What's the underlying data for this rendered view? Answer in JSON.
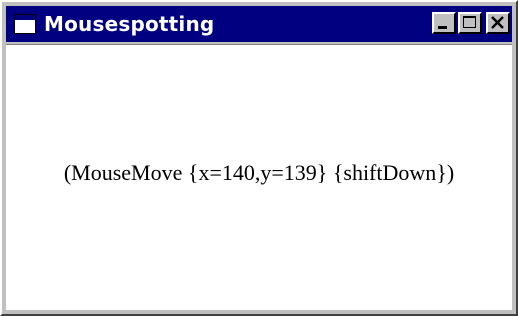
{
  "window": {
    "title": "Mousespotting",
    "app_icon": "window-icon",
    "controls": {
      "minimize_icon": "minimize-icon",
      "maximize_icon": "maximize-icon",
      "close_icon": "close-icon"
    }
  },
  "content": {
    "event_text": "(MouseMove {x=140,y=139} {shiftDown})"
  },
  "colors": {
    "titlebar": "#000080",
    "frame": "#c0c0c0",
    "client": "#ffffff"
  }
}
